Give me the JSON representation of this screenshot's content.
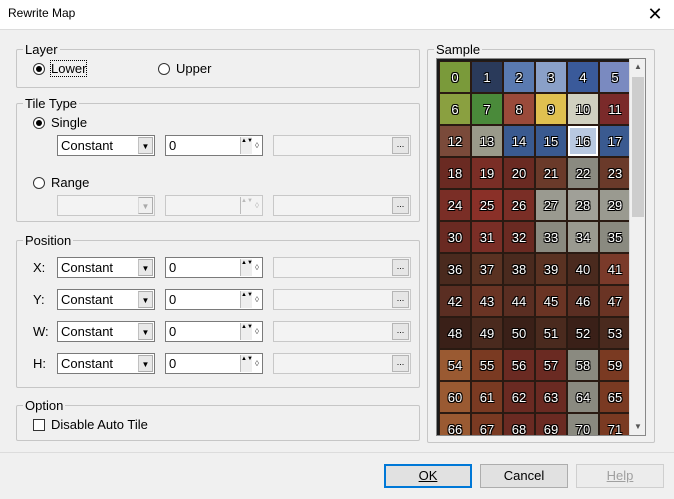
{
  "window": {
    "title": "Rewrite Map",
    "close_glyph": "✕"
  },
  "layer": {
    "label": "Layer",
    "lower_label": "Lower",
    "upper_label": "Upper",
    "selected": "Lower"
  },
  "tile_type": {
    "label": "Tile Type",
    "single_label": "Single",
    "range_label": "Range",
    "selected": "Single",
    "single_combo": "Constant",
    "single_value": "0"
  },
  "position": {
    "label": "Position",
    "rows": [
      {
        "label": "X:",
        "combo": "Constant",
        "value": "0"
      },
      {
        "label": "Y:",
        "combo": "Constant",
        "value": "0"
      },
      {
        "label": "W:",
        "combo": "Constant",
        "value": "0"
      },
      {
        "label": "H:",
        "combo": "Constant",
        "value": "0"
      }
    ]
  },
  "option": {
    "label": "Option",
    "disable_auto_tile_label": "Disable Auto Tile",
    "disable_auto_tile_checked": false
  },
  "sample": {
    "label": "Sample",
    "selected_tile": "16",
    "tiles": [
      {
        "n": "0",
        "c": "#7a9a3a"
      },
      {
        "n": "1",
        "c": "#2a3a5a"
      },
      {
        "n": "2",
        "c": "#5a7ab0"
      },
      {
        "n": "3",
        "c": "#8aa0c8"
      },
      {
        "n": "4",
        "c": "#3a5a9a"
      },
      {
        "n": "5",
        "c": "#7a8ac0"
      },
      {
        "n": "6",
        "c": "#8aa040"
      },
      {
        "n": "7",
        "c": "#4a8a3a"
      },
      {
        "n": "8",
        "c": "#9a4a3a"
      },
      {
        "n": "9",
        "c": "#e0c050"
      },
      {
        "n": "10",
        "c": "#d0d0c0"
      },
      {
        "n": "11",
        "c": "#7a2a2a"
      },
      {
        "n": "12",
        "c": "#7a4a3a"
      },
      {
        "n": "13",
        "c": "#9a9a8a"
      },
      {
        "n": "14",
        "c": "#3a5a90"
      },
      {
        "n": "15",
        "c": "#3a5a90"
      },
      {
        "n": "16",
        "c": "#b8c8e0"
      },
      {
        "n": "17",
        "c": "#3a5a90"
      },
      {
        "n": "18",
        "c": "#6a2a22"
      },
      {
        "n": "19",
        "c": "#7a2e26"
      },
      {
        "n": "20",
        "c": "#6a2a22"
      },
      {
        "n": "21",
        "c": "#6a3a2a"
      },
      {
        "n": "22",
        "c": "#8a8a80"
      },
      {
        "n": "23",
        "c": "#6a3a2a"
      },
      {
        "n": "24",
        "c": "#7a2e26"
      },
      {
        "n": "25",
        "c": "#8a3028"
      },
      {
        "n": "26",
        "c": "#7a2e26"
      },
      {
        "n": "27",
        "c": "#9a9a90"
      },
      {
        "n": "28",
        "c": "#a0a098"
      },
      {
        "n": "29",
        "c": "#9a9a90"
      },
      {
        "n": "30",
        "c": "#6a2a22"
      },
      {
        "n": "31",
        "c": "#7a2e26"
      },
      {
        "n": "32",
        "c": "#6a2a22"
      },
      {
        "n": "33",
        "c": "#8a8a80"
      },
      {
        "n": "34",
        "c": "#9a9a90"
      },
      {
        "n": "35",
        "c": "#8a8a80"
      },
      {
        "n": "36",
        "c": "#4a2a1e"
      },
      {
        "n": "37",
        "c": "#5a3222"
      },
      {
        "n": "38",
        "c": "#4a2a1e"
      },
      {
        "n": "39",
        "c": "#5a3222"
      },
      {
        "n": "40",
        "c": "#4a2a1e"
      },
      {
        "n": "41",
        "c": "#7a3a2a"
      },
      {
        "n": "42",
        "c": "#5a2e22"
      },
      {
        "n": "43",
        "c": "#6a3424"
      },
      {
        "n": "44",
        "c": "#5a2e22"
      },
      {
        "n": "45",
        "c": "#6a3424"
      },
      {
        "n": "46",
        "c": "#5a2e22"
      },
      {
        "n": "47",
        "c": "#6a3424"
      },
      {
        "n": "48",
        "c": "#3a2018"
      },
      {
        "n": "49",
        "c": "#4a2a1e"
      },
      {
        "n": "50",
        "c": "#3a2018"
      },
      {
        "n": "51",
        "c": "#4a2a1e"
      },
      {
        "n": "52",
        "c": "#3a2018"
      },
      {
        "n": "53",
        "c": "#4a2a1e"
      },
      {
        "n": "54",
        "c": "#9a5a32"
      },
      {
        "n": "55",
        "c": "#7a3a22"
      },
      {
        "n": "56",
        "c": "#6a2a22"
      },
      {
        "n": "57",
        "c": "#6a2a22"
      },
      {
        "n": "58",
        "c": "#8a8a80"
      },
      {
        "n": "59",
        "c": "#7a3a22"
      },
      {
        "n": "60",
        "c": "#9a5a32"
      },
      {
        "n": "61",
        "c": "#7a3a22"
      },
      {
        "n": "62",
        "c": "#6a2a22"
      },
      {
        "n": "63",
        "c": "#6a2a22"
      },
      {
        "n": "64",
        "c": "#8a8a80"
      },
      {
        "n": "65",
        "c": "#7a3a22"
      },
      {
        "n": "66",
        "c": "#9a5a32"
      },
      {
        "n": "67",
        "c": "#7a3a22"
      },
      {
        "n": "68",
        "c": "#6a2a22"
      },
      {
        "n": "69",
        "c": "#6a2a22"
      },
      {
        "n": "70",
        "c": "#8a8a80"
      },
      {
        "n": "71",
        "c": "#7a3a22"
      }
    ]
  },
  "buttons": {
    "ok": "OK",
    "cancel": "Cancel",
    "help": "Help"
  },
  "glyphs": {
    "dropdown": "▼",
    "spin": "▲▼",
    "ellipsis": "...",
    "scroll_up": "▲",
    "scroll_down": "▼"
  }
}
